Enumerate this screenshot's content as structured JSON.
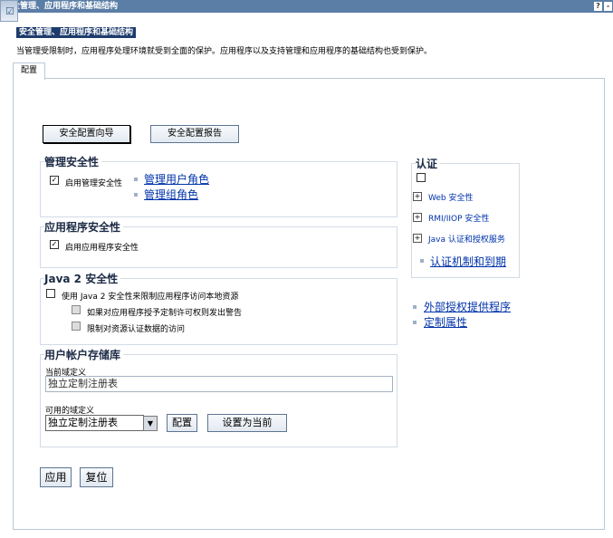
{
  "window": {
    "title": "安全管理、应用程序和基础结构",
    "help_button": "?",
    "close_button": "-"
  },
  "portlet": {
    "title": "安全管理、应用程序和基础结构",
    "description": "当管理受限制时，应用程序处理环境就受到全面的保护。应用程序以及支持管理和应用程序的基础结构也受到保护。"
  },
  "tabs": [
    {
      "label": "配置",
      "selected": true
    }
  ],
  "wizard_buttons": {
    "wizard": "安全配置向导",
    "report": "安全配置报告"
  },
  "admin_security": {
    "heading": "管理安全性",
    "enable_label": "启用管理安全性",
    "enabled": true,
    "links": [
      "管理用户角色",
      "管理组角色"
    ]
  },
  "app_security": {
    "heading": "应用程序安全性",
    "enable_label": "启用应用程序安全性",
    "enabled": true
  },
  "java2_security": {
    "heading": "Java 2 安全性",
    "use_label": "使用 Java 2 安全性来限制应用程序访问本地资源",
    "warn_label": "如果对应用程序授予定制许可权则发出警告",
    "restrict_label": "限制对资源认证数据的访问",
    "enabled": false
  },
  "user_registry": {
    "heading": "用户帐户存储库",
    "current_label": "当前域定义",
    "current_value": "独立定制注册表",
    "available_label": "可用的域定义",
    "available_selected": "独立定制注册表",
    "configure_button": "配置",
    "set_current_button": "设置为当前"
  },
  "authentication": {
    "heading": "认证",
    "items": [
      "Web 安全性",
      "RMI/IIOP 安全性",
      "Java 认证和授权服务"
    ],
    "link": "认证机制和到期"
  },
  "side_links": [
    "外部授权提供程序",
    "定制属性"
  ],
  "actions": {
    "apply": "应用",
    "reset": "复位"
  }
}
